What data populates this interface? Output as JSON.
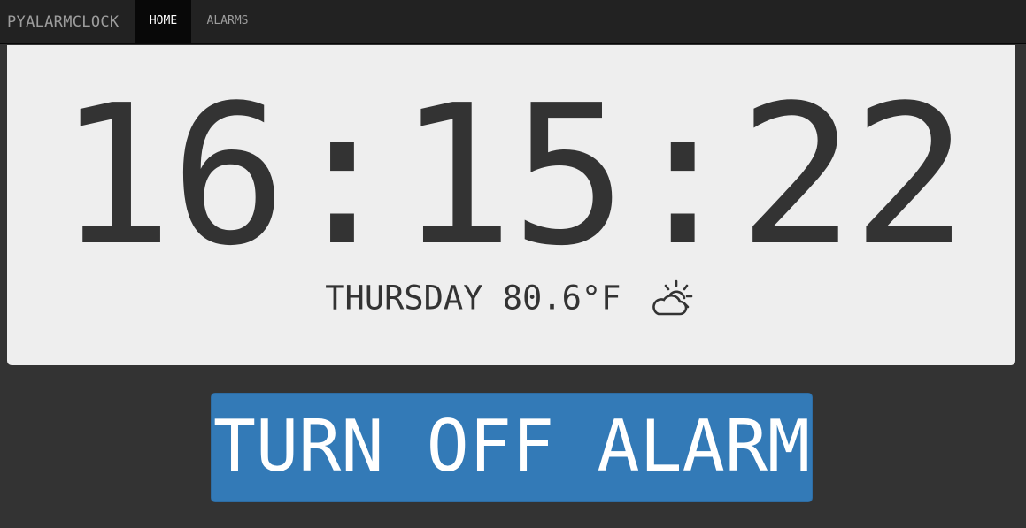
{
  "navbar": {
    "brand": "PYALARMCLOCK",
    "items": [
      {
        "label": "HOME",
        "active": true
      },
      {
        "label": "ALARMS",
        "active": false
      }
    ]
  },
  "clock": {
    "time": "16:15:22"
  },
  "status": {
    "day": "THURSDAY",
    "temperature": "80.6°F",
    "weather_icon": "partly-cloudy-day-icon"
  },
  "actions": {
    "turn_off_alarm_label": "TURN OFF ALARM"
  },
  "colors": {
    "background": "#333333",
    "navbar": "#222222",
    "panel": "#eeeeee",
    "button": "#337ab7"
  }
}
